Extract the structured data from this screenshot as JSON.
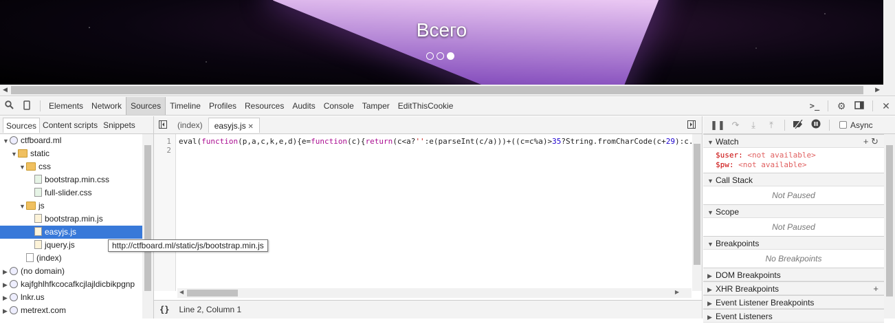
{
  "banner": {
    "title": "Всего",
    "slides_total": 3,
    "active_slide_index": 2
  },
  "devtools": {
    "tabs": [
      "Elements",
      "Network",
      "Sources",
      "Timeline",
      "Profiles",
      "Resources",
      "Audits",
      "Console",
      "Tamper",
      "EditThisCookie"
    ],
    "active_tab": "Sources",
    "navigator": {
      "tabs": [
        "Sources",
        "Content scripts",
        "Snippets"
      ],
      "active_tab": "Sources",
      "tree": [
        {
          "label": "ctfboard.ml",
          "type": "domain",
          "depth": 0,
          "expanded": true
        },
        {
          "label": "static",
          "type": "folder",
          "depth": 1,
          "expanded": true
        },
        {
          "label": "css",
          "type": "folder",
          "depth": 2,
          "expanded": true
        },
        {
          "label": "bootstrap.min.css",
          "type": "css",
          "depth": 3
        },
        {
          "label": "full-slider.css",
          "type": "css",
          "depth": 3
        },
        {
          "label": "js",
          "type": "folder",
          "depth": 2,
          "expanded": true
        },
        {
          "label": "bootstrap.min.js",
          "type": "js",
          "depth": 3
        },
        {
          "label": "easyjs.js",
          "type": "js",
          "depth": 3,
          "selected": true
        },
        {
          "label": "jquery.js",
          "type": "js",
          "depth": 3
        },
        {
          "label": "(index)",
          "type": "page",
          "depth": 2
        },
        {
          "label": "(no domain)",
          "type": "domain",
          "depth": 0,
          "expanded": false
        },
        {
          "label": "kajfghlhfkcocafkcjlajldicbikpgnp",
          "type": "domain",
          "depth": 0,
          "expanded": false
        },
        {
          "label": "lnkr.us",
          "type": "domain",
          "depth": 0,
          "expanded": false
        },
        {
          "label": "metrext.com",
          "type": "domain",
          "depth": 0,
          "expanded": false
        }
      ]
    },
    "tooltip": "http://ctfboard.ml/static/js/bootstrap.min.js",
    "editor": {
      "tabs": [
        {
          "label": "(index)",
          "active": false,
          "closable": false
        },
        {
          "label": "easyjs.js",
          "active": true,
          "closable": true
        }
      ],
      "line_numbers": [
        "1",
        "2"
      ],
      "code_line_1": "eval(function(p,a,c,k,e,d){e=function(c){return(c<a?'':e(parseInt(c/a)))+((c=c%a)>35?String.fromCharCode(c+29):c.",
      "status": {
        "braces": "{}",
        "position": "Line 2, Column 1"
      }
    },
    "debugger": {
      "async_label": "Async",
      "panes": [
        {
          "title": "Watch",
          "expanded": true,
          "items": [
            {
              "name": "$user:",
              "value": "<not available>"
            },
            {
              "name": "$pw:",
              "value": "<not available>"
            }
          ]
        },
        {
          "title": "Call Stack",
          "expanded": true,
          "placeholder": "Not Paused"
        },
        {
          "title": "Scope",
          "expanded": true,
          "placeholder": "Not Paused"
        },
        {
          "title": "Breakpoints",
          "expanded": true,
          "placeholder": "No Breakpoints"
        },
        {
          "title": "DOM Breakpoints",
          "expanded": false
        },
        {
          "title": "XHR Breakpoints",
          "expanded": false
        },
        {
          "title": "Event Listener Breakpoints",
          "expanded": false
        },
        {
          "title": "Event Listeners",
          "expanded": false
        }
      ]
    }
  }
}
